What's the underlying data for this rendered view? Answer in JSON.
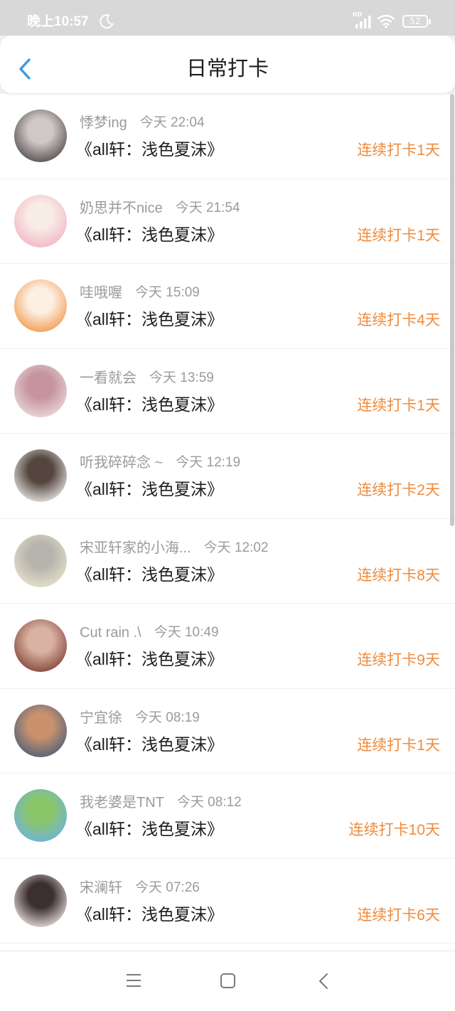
{
  "status_bar": {
    "time": "晚上10:57",
    "network_label": "HD",
    "battery": "52",
    "icons": [
      "moon-icon",
      "signal-icon",
      "wifi-icon",
      "battery-icon"
    ]
  },
  "header": {
    "title": "日常打卡",
    "back_icon": "chevron-left-icon"
  },
  "colors": {
    "accent": "#3a98e3",
    "streak": "#ef8b3d"
  },
  "checkins": [
    {
      "name": "悸梦ing",
      "time": "今天 22:04",
      "title": "《all轩：浅色夏沫》",
      "streak": "连续打卡1天",
      "avatar_colors": [
        "#4f4749",
        "#cfc8c6"
      ]
    },
    {
      "name": "奶思并不nice",
      "time": "今天 21:54",
      "title": "《all轩：浅色夏沫》",
      "streak": "连续打卡1天",
      "avatar_colors": [
        "#f2b3c1",
        "#f8ece6"
      ]
    },
    {
      "name": "哇哦喔",
      "time": "今天 15:09",
      "title": "《all轩：浅色夏沫》",
      "streak": "连续打卡4天",
      "avatar_colors": [
        "#f3964a",
        "#fcefe4"
      ]
    },
    {
      "name": "一看就会",
      "time": "今天 13:59",
      "title": "《all轩：浅色夏沫》",
      "streak": "连续打卡1天",
      "avatar_colors": [
        "#ecdcdd",
        "#c5949d"
      ]
    },
    {
      "name": "听我碎碎念 ~",
      "time": "今天 12:19",
      "title": "《all轩：浅色夏沫》",
      "streak": "连续打卡2天",
      "avatar_colors": [
        "#f0edec",
        "#54463f"
      ]
    },
    {
      "name": "宋亚轩家的小海...",
      "time": "今天 12:02",
      "title": "《all轩：浅色夏沫》",
      "streak": "连续打卡8天",
      "avatar_colors": [
        "#e9e3cd",
        "#b6b4ad"
      ]
    },
    {
      "name": "Cut rain .\\",
      "time": "今天 10:49",
      "title": "《all轩：浅色夏沫》",
      "streak": "连续打卡9天",
      "avatar_colors": [
        "#7e3f31",
        "#d9b2a4"
      ]
    },
    {
      "name": "宁宜徐",
      "time": "今天 08:19",
      "title": "《all轩：浅色夏沫》",
      "streak": "连续打卡1天",
      "avatar_colors": [
        "#4a5d7b",
        "#c9926d"
      ]
    },
    {
      "name": "我老婆是TNT",
      "time": "今天 08:12",
      "title": "《all轩：浅色夏沫》",
      "streak": "连续打卡10天",
      "avatar_colors": [
        "#6db2e4",
        "#8bc56a"
      ]
    },
    {
      "name": "宋澜轩",
      "time": "今天 07:26",
      "title": "《all轩：浅色夏沫》",
      "streak": "连续打卡6天",
      "avatar_colors": [
        "#f3e6e7",
        "#3b2f2f"
      ]
    }
  ],
  "nav": {
    "icons": [
      "menu-icon",
      "home-icon",
      "back-icon"
    ]
  }
}
